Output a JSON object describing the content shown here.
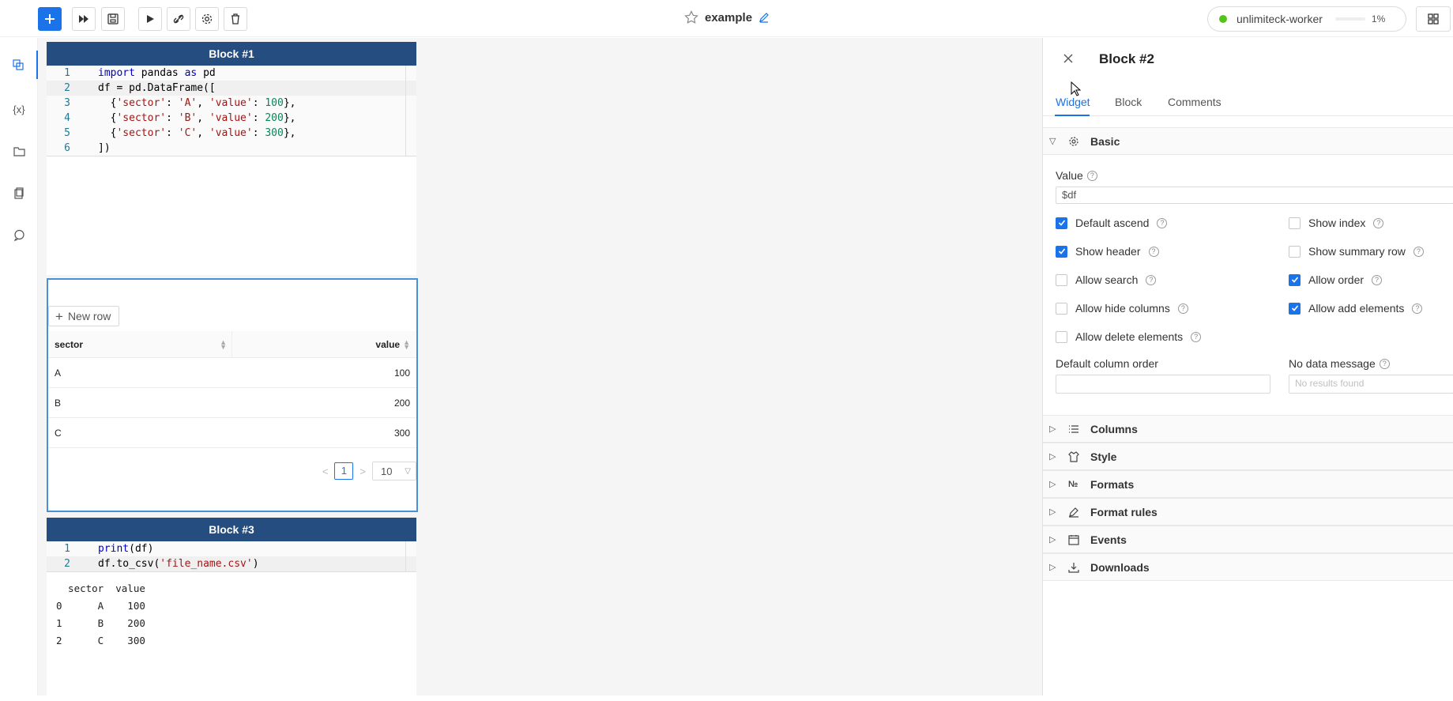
{
  "toolbar": {
    "add_icon": "plus-icon",
    "run_all_icon": "fast-forward-icon",
    "save_icon": "save-icon",
    "run_icon": "play-icon",
    "disconnect_icon": "disconnect-icon",
    "settings_icon": "gear-icon",
    "delete_icon": "trash-icon"
  },
  "header": {
    "title": "example"
  },
  "worker": {
    "name": "unlimiteck-worker",
    "status_color": "#52c41a",
    "progress_label": "1%",
    "progress": 0.01
  },
  "nav": [
    "blocks-icon",
    "variables-icon",
    "folder-icon",
    "clipboard-icon",
    "chat-icon"
  ],
  "block1": {
    "title": "Block #1",
    "line_numbers": [
      "1",
      "2",
      "3",
      "4",
      "5",
      "6"
    ]
  },
  "block3": {
    "title": "Block #3",
    "line_numbers": [
      "1",
      "2"
    ],
    "output": "  sector  value\n0      A    100\n1      B    200\n2      C    300"
  },
  "widget": {
    "new_row": "New row",
    "columns": [
      "sector",
      "value"
    ],
    "rows": [
      [
        "A",
        "100"
      ],
      [
        "B",
        "200"
      ],
      [
        "C",
        "300"
      ]
    ],
    "pager": {
      "prev": "<",
      "page": "1",
      "next": ">",
      "page_size": "10"
    }
  },
  "panel": {
    "title": "Block #2",
    "tabs": [
      "Widget",
      "Block",
      "Comments"
    ],
    "basic_section": "Basic",
    "value_label": "Value",
    "value": "$df",
    "checkboxes": [
      {
        "label": "Default ascend",
        "checked": true
      },
      {
        "label": "Show index",
        "checked": false
      },
      {
        "label": "Show header",
        "checked": true
      },
      {
        "label": "Show summary row",
        "checked": false
      },
      {
        "label": "Allow search",
        "checked": false
      },
      {
        "label": "Allow order",
        "checked": true
      },
      {
        "label": "Allow hide columns",
        "checked": false
      },
      {
        "label": "Allow add elements",
        "checked": true
      },
      {
        "label": "Allow delete elements",
        "checked": false
      }
    ],
    "default_column_order_label": "Default column order",
    "default_column_order_value": "",
    "no_data_label": "No data message",
    "no_data_placeholder": "No results found",
    "sections": [
      "Columns",
      "Style",
      "Formats",
      "Format rules",
      "Events",
      "Downloads"
    ],
    "section_icons": [
      "list-icon",
      "shirt-icon",
      "number-sign-icon",
      "brush-icon",
      "calendar-icon",
      "download-icon"
    ],
    "formats_icon_glyph": "№"
  }
}
